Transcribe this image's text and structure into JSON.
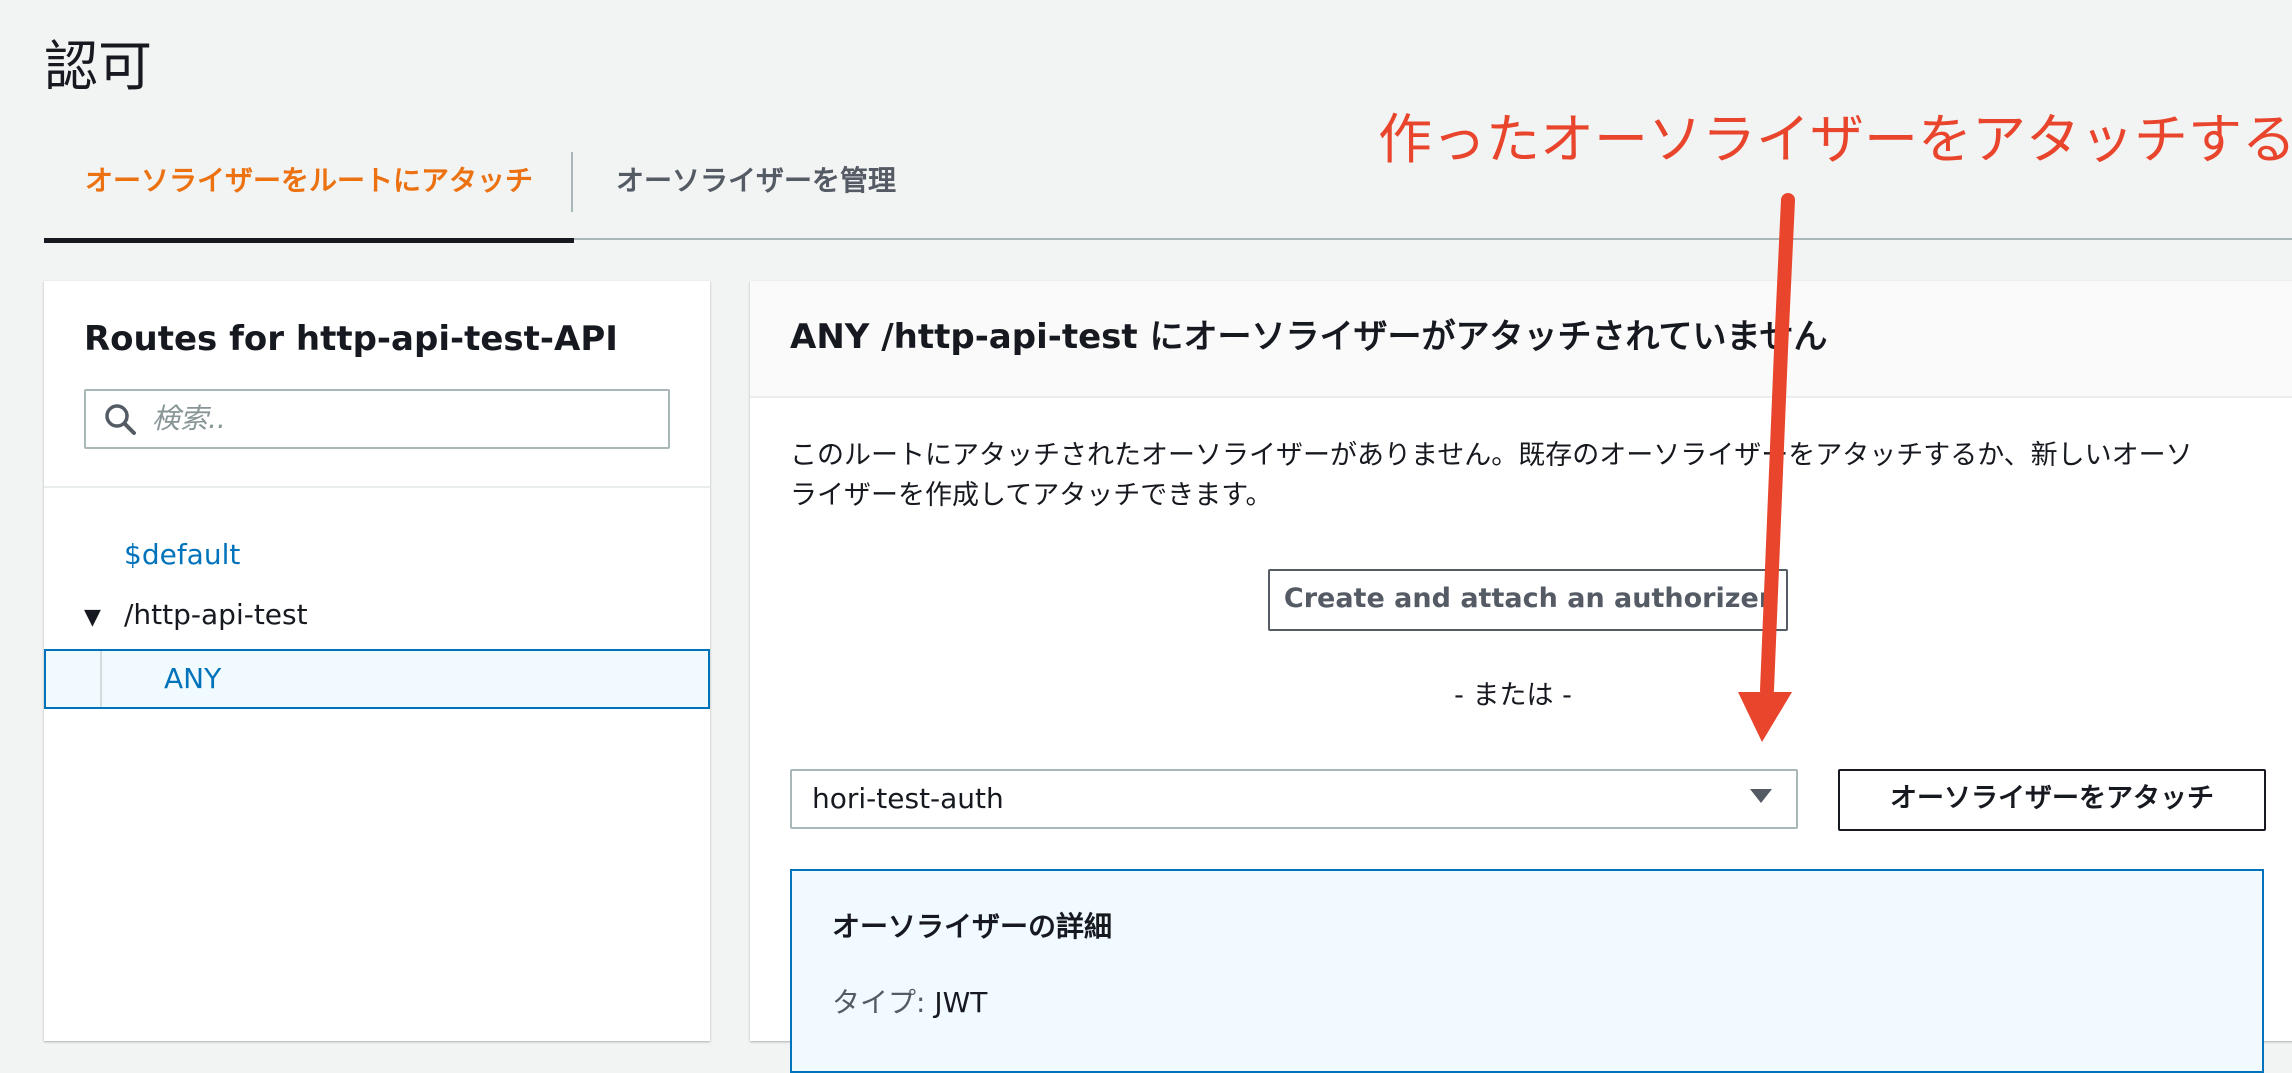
{
  "page": {
    "title": "認可"
  },
  "tabs": [
    {
      "label": "オーソライザーをルートにアタッチ",
      "active": true
    },
    {
      "label": "オーソライザーを管理",
      "active": false
    }
  ],
  "annotation": {
    "text": "作ったオーソライザーをアタッチする",
    "color": "#e8452c"
  },
  "routes": {
    "title": "Routes for http-api-test-API",
    "search_placeholder": "検索..",
    "items": [
      {
        "label": "$default"
      },
      {
        "label": "/http-api-test",
        "expanded": true,
        "expander": "▼"
      },
      {
        "label": "ANY",
        "selected": true
      }
    ]
  },
  "main": {
    "title": "ANY /http-api-test にオーソライザーがアタッチされていません",
    "description_line1": "このルートにアタッチされたオーソライザーがありません。既存のオーソライザーをアタッチするか、新しいオーソ",
    "description_line2": "ライザーを作成してアタッチできます。",
    "create_button": "Create and attach an authorizer",
    "or_text": "- または -",
    "select_value": "hori-test-auth",
    "attach_button": "オーソライザーをアタッチ",
    "details": {
      "title": "オーソライザーの詳細",
      "type_label": "タイプ:",
      "type_value": "JWT"
    }
  },
  "colors": {
    "accent_orange": "#ec7211",
    "link_blue": "#0073bb",
    "background": "#f2f3f3"
  }
}
